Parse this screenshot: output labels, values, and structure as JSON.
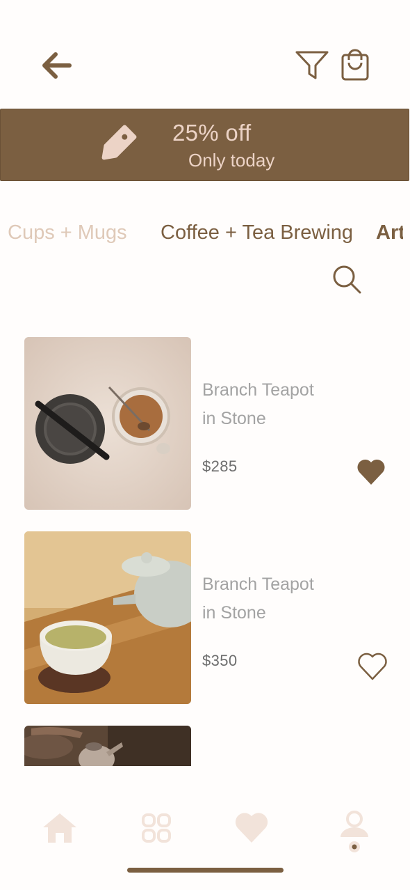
{
  "header": {
    "back_icon": "arrow-left-icon",
    "filter_icon": "filter-icon",
    "bag_icon": "shopping-bag-icon"
  },
  "promo": {
    "title": "25% off",
    "subtitle": "Only today",
    "icon": "price-tag-icon",
    "color": "#7b5f41"
  },
  "categories": [
    {
      "label": "Cups + Mugs"
    },
    {
      "label": "Coffee + Tea Brewing"
    },
    {
      "label": "Art"
    }
  ],
  "search": {
    "icon": "search-icon"
  },
  "products": [
    {
      "name_line1": "Branch Teapot",
      "name_line2": "in Stone",
      "price": "$285",
      "favorited": true
    },
    {
      "name_line1": "Branch Teapot",
      "name_line2": "in Stone",
      "price": "$350",
      "favorited": false
    }
  ],
  "tabbar": {
    "items": [
      "home-icon",
      "grid-icon",
      "heart-icon",
      "profile-icon"
    ],
    "color": "#f2e3da"
  },
  "colors": {
    "accent": "#7b5f41",
    "muted_text": "#a3a3a3",
    "inactive_category": "#dfc9b8"
  }
}
